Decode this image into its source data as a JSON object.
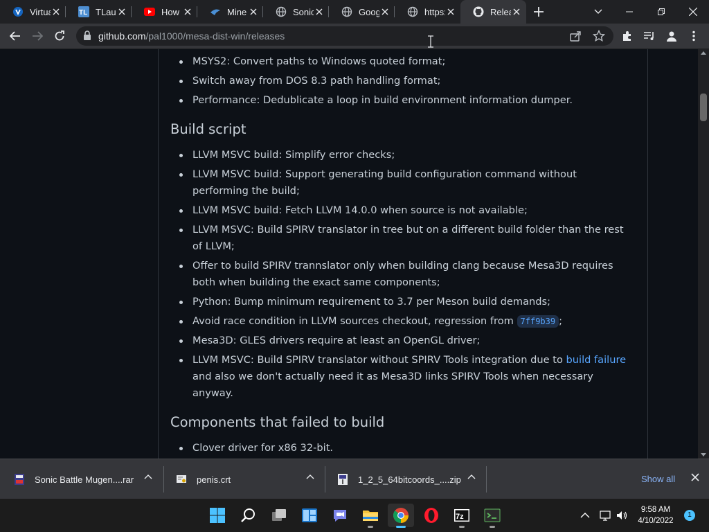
{
  "browser": {
    "tabs": [
      {
        "title": "Virtua",
        "icon": "virtualbox-icon"
      },
      {
        "title": "TLaun",
        "icon": "tlauncher-icon"
      },
      {
        "title": "How",
        "icon": "youtube-icon"
      },
      {
        "title": "Mine",
        "icon": "minecraft-icon"
      },
      {
        "title": "Sonic",
        "icon": "globe-icon"
      },
      {
        "title": "Goog",
        "icon": "globe-icon"
      },
      {
        "title": "https:",
        "icon": "globe-icon"
      },
      {
        "title": "Relea",
        "icon": "github-icon"
      }
    ],
    "active_tab_index": 7,
    "address": {
      "host": "github.com",
      "path": "/pal1000/mesa-dist-win/releases"
    }
  },
  "page": {
    "intro_items": [
      "MSYS2: Convert paths to Windows quoted format;",
      "Switch away from DOS 8.3 path handling format;",
      "Performance: Dedublicate a loop in build environment information dumper."
    ],
    "build_heading": "Build script",
    "build_items": [
      {
        "text": "LLVM MSVC build: Simplify error checks;"
      },
      {
        "text": "LLVM MSVC build: Support generating build configuration command without performing the build;"
      },
      {
        "text": "LLVM MSVC build: Fetch LLVM 14.0.0 when source is not available;"
      },
      {
        "text": "LLVM MSVC: Build SPIRV translator in tree but on a different build folder than the rest of LLVM;"
      },
      {
        "text": "Offer to build SPIRV trannslator only when building clang because Mesa3D requires both when building the exact same components;"
      },
      {
        "text": "Python: Bump minimum requirement to 3.7 per Meson build demands;"
      },
      {
        "text_before": "Avoid race condition in LLVM sources checkout, regression from ",
        "code": "7ff9b39",
        "text_after": ";"
      },
      {
        "text": "Mesa3D: GLES drivers require at least an OpenGL driver;"
      },
      {
        "text_before": "LLVM MSVC: Build SPIRV translator without SPIRV Tools integration due to ",
        "link": "build failure",
        "text_after": " and also we don't actually need it as Mesa3D links SPIRV Tools when necessary anyway."
      }
    ],
    "failed_heading": "Components that failed to build",
    "failed_items": [
      "Clover driver for x86 32-bit."
    ]
  },
  "downloads": {
    "items": [
      {
        "name": "Sonic Battle Mugen....rar",
        "icon": "rar-archive-icon"
      },
      {
        "name": "penis.crt",
        "icon": "certificate-icon"
      },
      {
        "name": "1_2_5_64bitcoords_....zip",
        "icon": "zip-archive-icon"
      }
    ],
    "show_all": "Show all"
  },
  "taskbar": {
    "apps": [
      "start-icon",
      "search-icon",
      "task-view-icon",
      "widgets-icon",
      "chat-icon",
      "file-explorer-icon",
      "chrome-icon",
      "opera-icon",
      "7zip-icon",
      "terminal-icon"
    ],
    "time": "9:58 AM",
    "date": "4/10/2022",
    "notifications": "1"
  },
  "colors": {
    "accent_link": "#58a6ff",
    "page_bg": "#0d1117",
    "chrome_bg": "#202124",
    "toolbar_bg": "#35363a"
  }
}
